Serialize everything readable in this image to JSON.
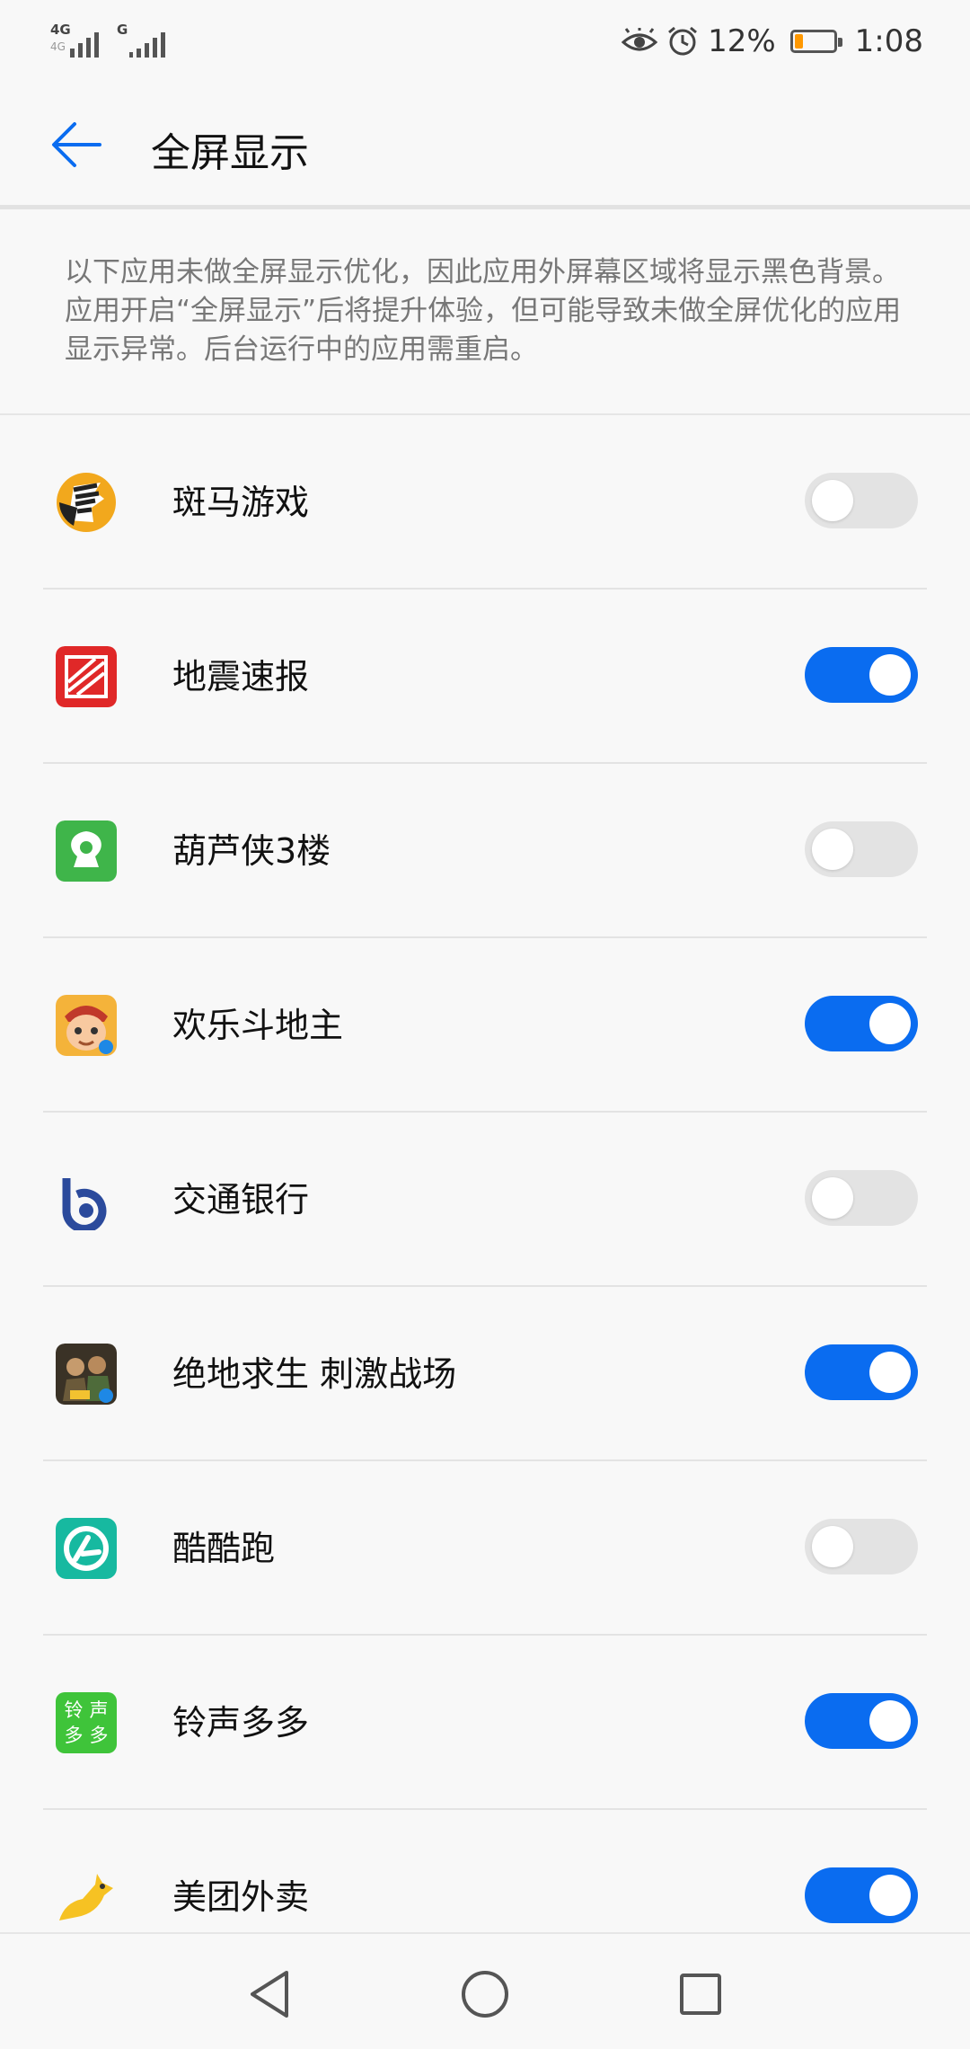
{
  "status_bar": {
    "sim1_type": "4G",
    "sim1_sub": "4G",
    "sim2_type": "G",
    "battery_text": "12%",
    "battery_level": 0.12,
    "time": "1:08",
    "icons": [
      "eye-comfort-icon",
      "alarm-icon",
      "battery-icon"
    ]
  },
  "header": {
    "title": "全屏显示",
    "back_icon": "arrow-left-icon"
  },
  "description": "以下应用未做全屏显示优化，因此应用外屏幕区域将显示黑色背景。应用开启“全屏显示”后将提升体验，但可能导致未做全屏优化的应用显示异常。后台运行中的应用需重启。",
  "apps": [
    {
      "name": "斑马游戏",
      "enabled": false,
      "icon": "zebra-icon"
    },
    {
      "name": "地震速报",
      "enabled": true,
      "icon": "earthquake-icon"
    },
    {
      "name": "葫芦侠3楼",
      "enabled": false,
      "icon": "gourd-icon"
    },
    {
      "name": "欢乐斗地主",
      "enabled": true,
      "icon": "doudizhu-icon"
    },
    {
      "name": "交通银行",
      "enabled": false,
      "icon": "bankcomm-icon"
    },
    {
      "name": "绝地求生 刺激战场",
      "enabled": true,
      "icon": "pubg-icon"
    },
    {
      "name": "酷酷跑",
      "enabled": false,
      "icon": "kukupao-icon"
    },
    {
      "name": "铃声多多",
      "enabled": true,
      "icon": "ringtone-icon",
      "icon_text": [
        "铃",
        "声",
        "多",
        "多"
      ]
    },
    {
      "name": "美团外卖",
      "enabled": true,
      "icon": "meituan-icon"
    }
  ],
  "nav": {
    "back": "nav-back-icon",
    "home": "nav-home-icon",
    "recent": "nav-recent-icon"
  },
  "colors": {
    "accent": "#0a6cf0",
    "toggle_off": "#e3e3e3",
    "background": "#f8f8f8",
    "battery": "#ff9800"
  }
}
